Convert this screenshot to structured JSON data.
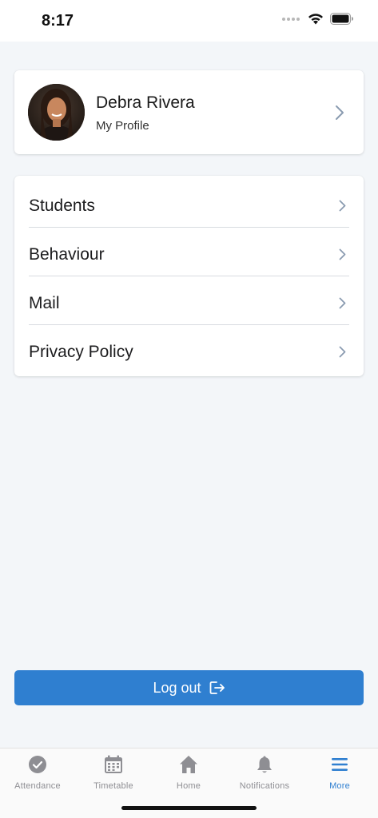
{
  "status_bar": {
    "time": "8:17"
  },
  "profile": {
    "name": "Debra Rivera",
    "subtitle": "My Profile"
  },
  "menu": {
    "items": [
      {
        "label": "Students"
      },
      {
        "label": "Behaviour"
      },
      {
        "label": "Mail"
      },
      {
        "label": "Privacy Policy"
      }
    ]
  },
  "logout": {
    "label": "Log out"
  },
  "tab_bar": {
    "tabs": [
      {
        "label": "Attendance",
        "icon": "check-circle-icon"
      },
      {
        "label": "Timetable",
        "icon": "calendar-icon"
      },
      {
        "label": "Home",
        "icon": "home-icon"
      },
      {
        "label": "Notifications",
        "icon": "bell-icon"
      },
      {
        "label": "More",
        "icon": "menu-icon"
      }
    ],
    "active": "More"
  },
  "colors": {
    "accent": "#2f7fd0",
    "background": "#f3f6f9",
    "inactive_tab": "#8e8e93",
    "chevron": "#8a9bb0"
  }
}
